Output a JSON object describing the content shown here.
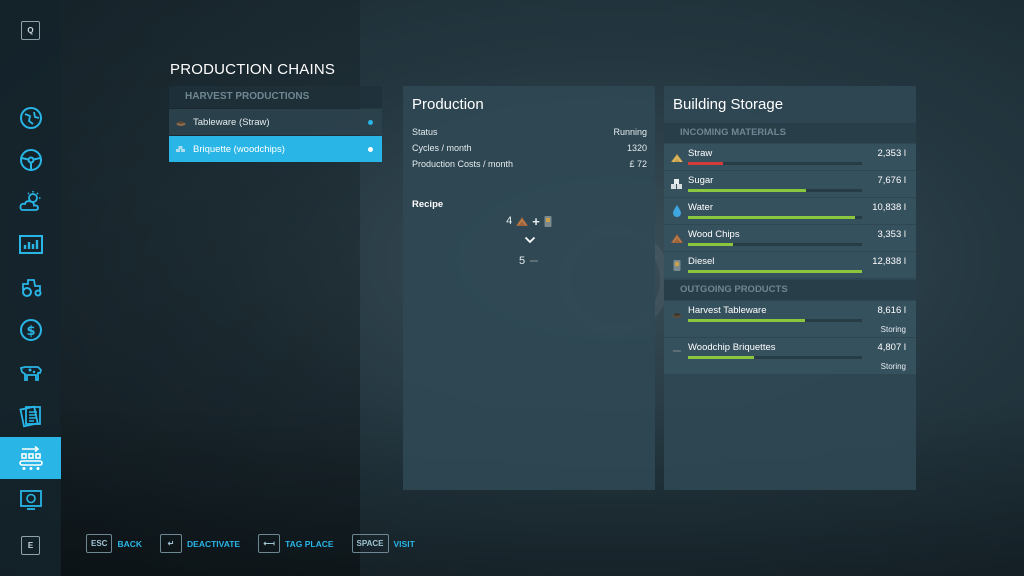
{
  "sidebar": {
    "top_key": "Q",
    "bottom_key": "E",
    "items": [
      {
        "icon": "map-icon"
      },
      {
        "icon": "steering-wheel-icon"
      },
      {
        "icon": "weather-icon"
      },
      {
        "icon": "statistics-icon"
      },
      {
        "icon": "tractor-icon"
      },
      {
        "icon": "finances-icon"
      },
      {
        "icon": "animals-icon"
      },
      {
        "icon": "contracts-icon"
      },
      {
        "icon": "production-chains-icon",
        "active": true
      },
      {
        "icon": "help-icon"
      }
    ]
  },
  "page_title": "PRODUCTION CHAINS",
  "list": {
    "header": "HARVEST PRODUCTIONS",
    "items": [
      {
        "label": "Tableware (Straw)",
        "selected": false
      },
      {
        "label": "Briquette (woodchips)",
        "selected": true
      }
    ]
  },
  "production": {
    "title": "Production",
    "rows": [
      {
        "key": "Status",
        "value": "Running"
      },
      {
        "key": "Cycles / month",
        "value": "1320"
      },
      {
        "key": "Production Costs / month",
        "value": "£ 72"
      }
    ],
    "recipe_label": "Recipe",
    "recipe_input_amount": "4",
    "recipe_plus": "+",
    "recipe_output_amount": "5"
  },
  "storage": {
    "title": "Building Storage",
    "incoming_header": "INCOMING MATERIALS",
    "incoming": [
      {
        "name": "Straw",
        "amount": "2,353 l",
        "fill": 0.2,
        "low": true,
        "icon": "straw-icon"
      },
      {
        "name": "Sugar",
        "amount": "7,676 l",
        "fill": 0.68,
        "icon": "sugar-icon"
      },
      {
        "name": "Water",
        "amount": "10,838 l",
        "fill": 0.96,
        "icon": "water-icon"
      },
      {
        "name": "Wood Chips",
        "amount": "3,353 l",
        "fill": 0.26,
        "icon": "woodchips-icon"
      },
      {
        "name": "Diesel",
        "amount": "12,838 l",
        "fill": 1.0,
        "icon": "diesel-icon"
      }
    ],
    "outgoing_header": "OUTGOING PRODUCTS",
    "outgoing": [
      {
        "name": "Harvest Tableware",
        "amount": "8,616 l",
        "fill": 0.67,
        "mode": "Storing",
        "icon": "tableware-icon"
      },
      {
        "name": "Woodchip Briquettes",
        "amount": "4,807 l",
        "fill": 0.38,
        "mode": "Storing",
        "icon": "briquettes-icon"
      }
    ]
  },
  "bottom_actions": [
    {
      "key": "ESC",
      "label": "BACK"
    },
    {
      "key": "↵",
      "label": "DEACTIVATE"
    },
    {
      "key": "⟻",
      "label": "TAG PLACE"
    },
    {
      "key": "SPACE",
      "label": "VISIT"
    }
  ],
  "colors": {
    "accent": "#29b5e6",
    "bar_green": "#8bc63f",
    "bar_red": "#d33a3a"
  }
}
